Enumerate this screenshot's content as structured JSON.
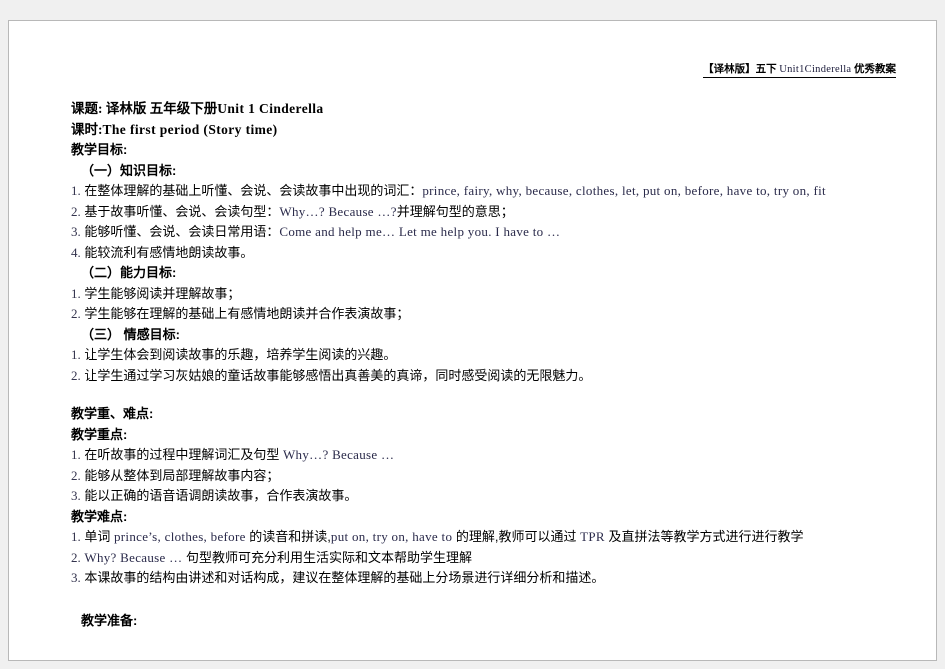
{
  "document": {
    "header_note": {
      "prefix": "【译林版】五下 ",
      "unit": "Unit1Cinderella",
      "suffix": " 优秀教案"
    },
    "title_lines": [
      {
        "label": "课题:",
        "value_cn": " 译林版 五年级下册",
        "value_en": "Unit 1 Cinderella"
      },
      {
        "label": "课时:",
        "value_cn": "",
        "value_en": "The first period (Story time)"
      }
    ],
    "sections": [
      {
        "heading": "教学目标:",
        "subsections": [
          {
            "heading": "（一）知识目标:",
            "items": [
              {
                "num": "1.",
                "cn_before": " 在整体理解的基础上听懂、会说、会读故事中出现的词汇：",
                "en": "prince, fairy, why, because, clothes, let, put on, before, have to, try on, fit",
                "cn_after": ""
              },
              {
                "num": "2.",
                "cn_before": " 基于故事听懂、会说、会读句型：",
                "en": "Why…? Because  …?",
                "cn_after": "并理解句型的意思；"
              },
              {
                "num": "3.",
                "cn_before": " 能够听懂、会说、会读日常用语：",
                "en": "Come and help me…  Let me help you. I have to  …",
                "cn_after": ""
              },
              {
                "num": "4.",
                "cn_before": " 能较流利有感情地朗读故事。",
                "en": "",
                "cn_after": ""
              }
            ]
          },
          {
            "heading": "（二）能力目标:",
            "items": [
              {
                "num": "1.",
                "cn_before": " 学生能够阅读并理解故事；",
                "en": "",
                "cn_after": ""
              },
              {
                "num": "2.",
                "cn_before": "   学生能够在理解的基础上有感情地朗读并合作表演故事；",
                "en": "",
                "cn_after": ""
              }
            ]
          },
          {
            "heading": "（三）  情感目标:",
            "items": [
              {
                "num": "1.",
                "cn_before": " 让学生体会到阅读故事的乐趣，培养学生阅读的兴趣。",
                "en": "",
                "cn_after": ""
              },
              {
                "num": "2.",
                "cn_before": " 让学生通过学习灰姑娘的童话故事能够感悟出真善美的真谛，同时感受阅读的无限魅力。",
                "en": "",
                "cn_after": ""
              }
            ]
          }
        ]
      },
      {
        "heading": "教学重、难点:",
        "subsections": [
          {
            "heading": "教学重点:",
            "items": [
              {
                "num": "1.",
                "cn_before": "   在听故事的过程中理解词汇及句型 ",
                "en": "Why…? Because  …",
                "cn_after": ""
              },
              {
                "num": "2.",
                "cn_before": "   能够从整体到局部理解故事内容；",
                "en": "",
                "cn_after": ""
              },
              {
                "num": "3.",
                "cn_before": "   能以正确的语音语调朗读故事，合作表演故事。",
                "en": "",
                "cn_after": ""
              }
            ]
          },
          {
            "heading": "教学难点:",
            "items": [
              {
                "num": "1.",
                "cn_before": " 单词 ",
                "en": "prince’s, clothes, before",
                "cn_after": " 的读音和拼读,",
                "en2": "put on, try on, have to",
                "cn_after2": " 的理解,教师可以通过 ",
                "en3": "TPR",
                "cn_after3": " 及直拼法等教学方式进行进行教学"
              },
              {
                "num": "2.",
                "cn_before": " ",
                "en": "Why? Because  …",
                "cn_after": "  句型教师可充分利用生活实际和文本帮助学生理解"
              },
              {
                "num": "3.",
                "cn_before": " 本课故事的结构由讲述和对话构成，建议在整体理解的基础上分场景进行详细分析和描述。",
                "en": "",
                "cn_after": ""
              }
            ]
          }
        ]
      },
      {
        "heading": "教学准备:",
        "subsections": []
      }
    ]
  },
  "colors": {
    "page_background": "#ffffff",
    "canvas_background": "#f0f0f0",
    "text": "#000000",
    "english_text": "#2a2a4a",
    "border": "#b8b8b8"
  }
}
